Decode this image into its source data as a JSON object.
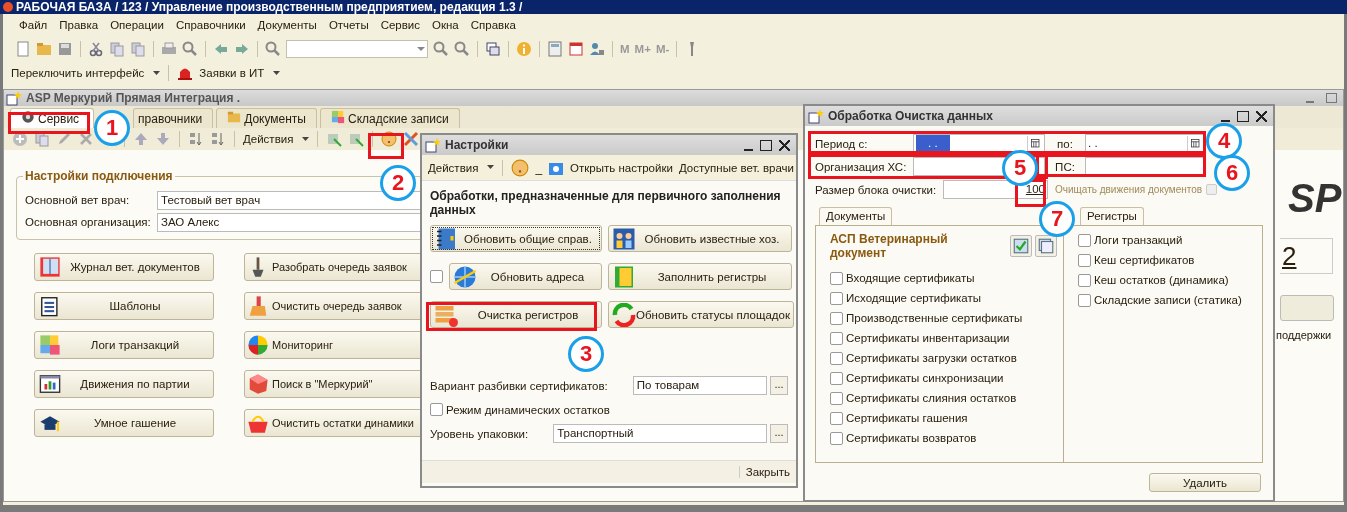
{
  "app_title": "РАБОЧАЯ БАЗА / 123 / Управление производственным предприятием, редакция 1.3 /",
  "menu": [
    "Файл",
    "Правка",
    "Операции",
    "Справочники",
    "Документы",
    "Отчеты",
    "Сервис",
    "Окна",
    "Справка"
  ],
  "memory_buttons": [
    "M",
    "M+",
    "M-"
  ],
  "toolbar2": [
    "Переключить интерфейс",
    "Заявки в ИТ"
  ],
  "child_window": {
    "title": "ASP Меркурий Прямая Интеграция .",
    "tabs": [
      {
        "label": "Сервис",
        "selected": true
      },
      {
        "label": "правочники",
        "selected": false
      },
      {
        "label": "Документы",
        "selected": false
      },
      {
        "label": "Складские записи",
        "selected": false
      }
    ],
    "actions_label": "Действия",
    "group_title": "Настройки подключения",
    "fields": [
      {
        "label": "Основной вет врач:",
        "value": "Тестовый вет врач"
      },
      {
        "label": "Основная организация:",
        "value": "ЗАО  Алекс"
      }
    ],
    "buttons": [
      "Журнал вет. документов",
      "Разобрать очередь заявок",
      "Шаблоны",
      "Очистить очередь заявок",
      "Логи транзакций",
      "Мониторинг",
      "Движения по партии",
      "Поиск в \"Меркурий\"",
      "Умное гашение",
      "Очистить остатки динамики"
    ],
    "logo": "SP",
    "partial_text": "2",
    "support_text": "поддержки"
  },
  "settings_dialog": {
    "title": "Настройки",
    "actions_label": "Действия",
    "separator": "_",
    "toolbar_links": [
      "Открыть настройки",
      "Доступные вет. врачи"
    ],
    "heading": "Обработки, предназначенные для первичного заполнения данных",
    "buttons": [
      {
        "label": "Обновить общие справ.",
        "focused": true
      },
      {
        "label": "Обновить известные хоз.",
        "focused": false
      },
      {
        "label": "Обновить адреса",
        "focused": false
      },
      {
        "label": "Заполнить регистры",
        "focused": false
      },
      {
        "label": "Очистка регистров",
        "focused": false
      },
      {
        "label": "Обновить статусы площадок",
        "focused": false
      }
    ],
    "address_checkbox": {
      "checked": false
    },
    "fields": [
      {
        "kind": "select",
        "label": "Вариант разбивки сертификатов:",
        "value": "По товарам",
        "button": "..."
      },
      {
        "kind": "checkbox",
        "label": "Режим динамических остатков",
        "checked": false
      },
      {
        "kind": "select",
        "label": "Уровень упаковки:",
        "value": "Транспортный",
        "button": "..."
      }
    ],
    "close_label": "Закрыть"
  },
  "cleanup_dialog": {
    "title": "Обработка  Очистка данных",
    "period_label": "Период с:",
    "period_from": ". .",
    "period_from_highlighted": true,
    "period_to_label": "по:",
    "period_to": ". .",
    "org_label": "Организация ХС:",
    "ps_label": "ПС:",
    "block_label": "Размер блока очистки:",
    "block_value": "100",
    "clear_moves": {
      "label": "Очищать движения документов",
      "disabled": true,
      "checked": false
    },
    "documents_tab": "Документы",
    "documents_heading": "АСП Ветеринарный документ",
    "documents": [
      {
        "label": "Входящие сертификаты",
        "checked": false
      },
      {
        "label": "Исходящие сертификаты",
        "checked": false
      },
      {
        "label": "Производственные сертификаты",
        "checked": false
      },
      {
        "label": "Сертификаты инвентаризации",
        "checked": false
      },
      {
        "label": "Сертификаты загрузки остатков",
        "checked": false
      },
      {
        "label": "Сертификаты синхронизации",
        "checked": false
      },
      {
        "label": "Сертификаты слияния остатков",
        "checked": false
      },
      {
        "label": "Сертификаты гашения",
        "checked": false
      },
      {
        "label": "Сертификаты возвратов",
        "checked": false
      }
    ],
    "registers_tab": "Регистры",
    "registers": [
      {
        "label": "Логи транзакций",
        "checked": false
      },
      {
        "label": "Кеш сертификатов",
        "checked": false
      },
      {
        "label": "Кеш остатков (динамика)",
        "checked": false
      },
      {
        "label": "Складские записи (статика)",
        "checked": false
      }
    ],
    "delete_label": "Удалить"
  },
  "annotations": [
    "1",
    "2",
    "3",
    "4",
    "5",
    "6",
    "7"
  ]
}
